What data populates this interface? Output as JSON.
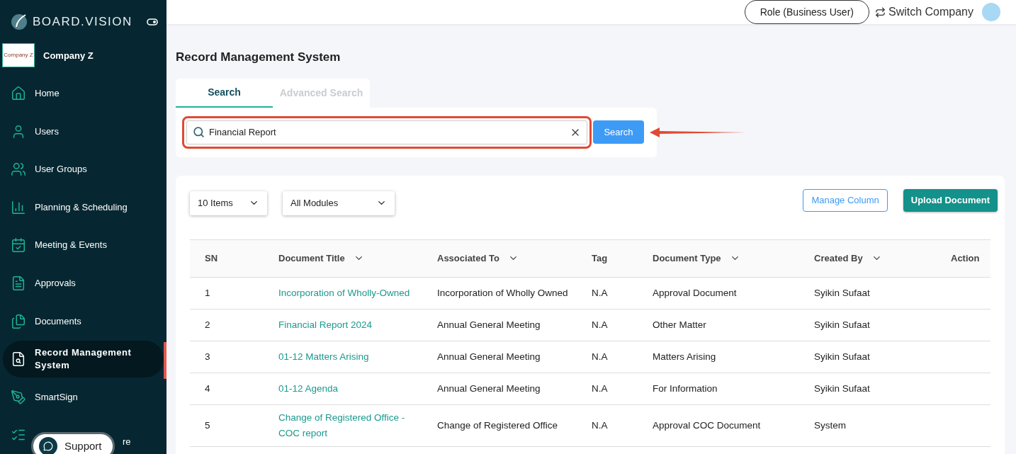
{
  "sidebar": {
    "brand": "BOARD.VISION",
    "company": {
      "logo_text": "Company Z",
      "name": "Company Z"
    },
    "items": [
      {
        "label": "Home",
        "selected": false
      },
      {
        "label": "Users",
        "selected": false
      },
      {
        "label": "User Groups",
        "selected": false
      },
      {
        "label": "Planning & Scheduling",
        "selected": false
      },
      {
        "label": "Meeting & Events",
        "selected": false
      },
      {
        "label": "Approvals",
        "selected": false
      },
      {
        "label": "Documents",
        "selected": false
      },
      {
        "label": "Record Management System",
        "selected": true
      },
      {
        "label": "SmartSign",
        "selected": false
      },
      {
        "label": "re",
        "selected": false
      }
    ],
    "support": "Support"
  },
  "header": {
    "role": "Role (Business User)",
    "switch": "Switch Company"
  },
  "page_title": "Record Management System",
  "tabs": [
    {
      "label": "Search",
      "selected": true
    },
    {
      "label": "Advanced Search",
      "selected": false
    }
  ],
  "search": {
    "value": "Financial Report",
    "button": "Search"
  },
  "toolbar": {
    "page_size": "10 Items",
    "module": "All Modules",
    "manage": "Manage Column",
    "upload": "Upload Document"
  },
  "table": {
    "columns": [
      {
        "label": "SN",
        "sortable": false
      },
      {
        "label": "Document Title",
        "sortable": true
      },
      {
        "label": "Associated To",
        "sortable": true
      },
      {
        "label": "Tag",
        "sortable": false
      },
      {
        "label": "Document Type",
        "sortable": true
      },
      {
        "label": "Created By",
        "sortable": true
      },
      {
        "label": "Action",
        "sortable": false
      }
    ],
    "rows": [
      [
        "1",
        "Incorporation of Wholly-Owned",
        "Incorporation of Wholly Owned",
        "N.A",
        "Approval Document",
        "Syikin Sufaat"
      ],
      [
        "2",
        "Financial Report 2024",
        "Annual General Meeting",
        "N.A",
        "Other Matter",
        "Syikin Sufaat"
      ],
      [
        "3",
        "01-12 Matters Arising",
        "Annual General Meeting",
        "N.A",
        "Matters Arising",
        "Syikin Sufaat"
      ],
      [
        "4",
        "01-12 Agenda",
        "Annual General Meeting",
        "N.A",
        "For Information",
        "Syikin Sufaat"
      ],
      [
        "5",
        "Change of Registered Office - COC report",
        "Change of Registered Office",
        "N.A",
        "Approval COC Document",
        "System"
      ]
    ]
  }
}
